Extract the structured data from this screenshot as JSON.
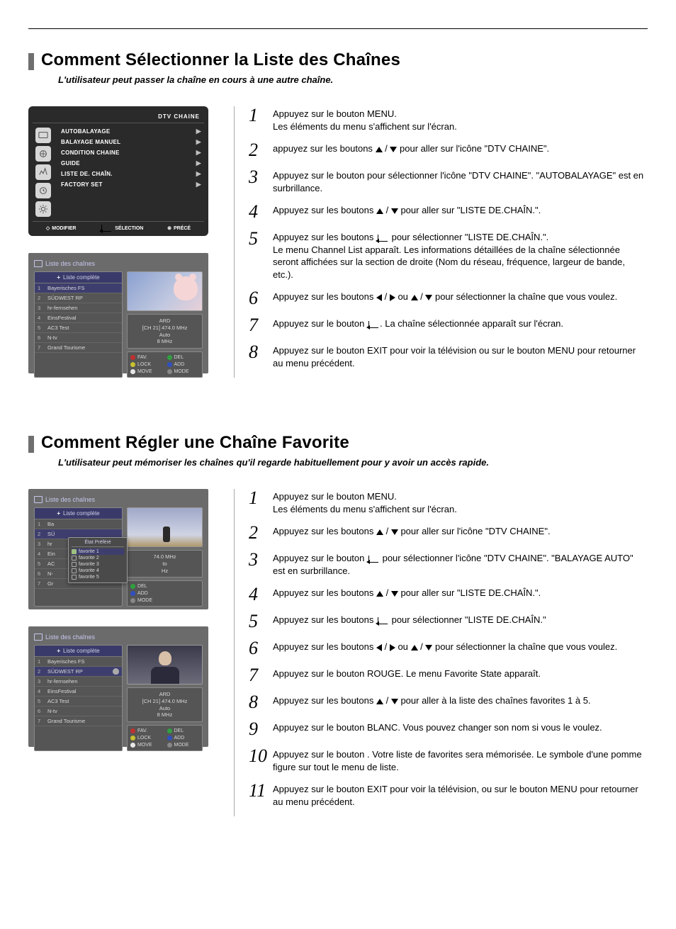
{
  "section1": {
    "title": "Comment Sélectionner la Liste des Chaînes",
    "subtitle": "L'utilisateur peut passer la chaîne en cours à une autre chaîne.",
    "osd": {
      "header": "DTV CHAINE",
      "items": [
        "AUTOBALAYAGE",
        "BALAYAGE MANUEL",
        "CONDITION CHAINE",
        "GUIDE",
        "LISTE DE. CHAÎN.",
        "FACTORY SET"
      ],
      "highlight_index": 4,
      "footer": {
        "modify": "MODIFIER",
        "select": "SÉLECTION",
        "back": "PRÉCÉ"
      }
    },
    "shot": {
      "title": "Liste des chaînes",
      "list_header": "Liste complète",
      "channels": [
        {
          "n": "1",
          "name": "Bayerisches FS"
        },
        {
          "n": "2",
          "name": "SÜDWEST RP"
        },
        {
          "n": "3",
          "name": "hr-fernsehen"
        },
        {
          "n": "4",
          "name": "EinsFestival"
        },
        {
          "n": "5",
          "name": "AC3 Test"
        },
        {
          "n": "6",
          "name": "N-tv"
        },
        {
          "n": "7",
          "name": "Grand Tourisme"
        }
      ],
      "info": {
        "name": "ARD",
        "ch": "[CH 21] 474.0 MHz",
        "mode": "Auto",
        "bw": "8 MHz"
      },
      "btns": {
        "fav": "FAV.",
        "del": "DEL",
        "lock": "LOCK",
        "add": "ADD",
        "move": "MOVE",
        "mode": "MODE"
      }
    },
    "steps": [
      {
        "n": "1",
        "t": "Appuyez sur le bouton MENU.\nLes éléments du menu s'affichent sur l'écran."
      },
      {
        "n": "2",
        "t": "appuyez sur les boutons {up} / {down} pour aller sur l'icône \"DTV CHAINE\"."
      },
      {
        "n": "3",
        "t": "Appuyez sur le bouton  pour sélectionner l'icône \"DTV CHAINE\". \"AUTOBALAYAGE\" est en surbrillance."
      },
      {
        "n": "4",
        "t": "Appuyez sur les boutons {up} / {down} pour aller sur \"LISTE DE.CHAÎN.\"."
      },
      {
        "n": "5",
        "t": "Appuyez sur les boutons {enter} pour sélectionner \"LISTE DE.CHAÎN.\".\nLe menu Channel List apparaît. Les informations détaillées de la chaîne sélectionnée seront affichées sur la section de droite (Nom du réseau, fréquence, largeur de bande, etc.)."
      },
      {
        "n": "6",
        "t": "Appuyez sur les boutons {left} / {right} ou {up} / {down} pour sélectionner la chaîne que vous voulez."
      },
      {
        "n": "7",
        "t": "Appuyez sur le bouton {enter}. La chaîne sélectionnée apparaît sur l'écran."
      },
      {
        "n": "8",
        "t": "Appuyez sur le bouton EXIT pour voir la télévision ou sur le bouton MENU pour retourner au menu précédent."
      }
    ]
  },
  "section2": {
    "title": "Comment Régler une Chaîne Favorite",
    "subtitle": "L'utilisateur peut mémoriser les chaînes qu'il regarde habituellement pour y avoir un accès rapide.",
    "shotA": {
      "title": "Liste des chaînes",
      "list_header": "Liste complète",
      "fav_header": "État Préféré",
      "channels": [
        {
          "n": "1",
          "name": "Ba"
        },
        {
          "n": "2",
          "name": "SÜ"
        },
        {
          "n": "3",
          "name": "hr"
        },
        {
          "n": "4",
          "name": "Ein"
        },
        {
          "n": "5",
          "name": "AC"
        },
        {
          "n": "6",
          "name": "N-"
        },
        {
          "n": "7",
          "name": "Gr"
        }
      ],
      "favs": [
        "favorite 1",
        "favorite 2",
        "favorite 3",
        "favorite 4",
        "favorite 5"
      ],
      "info_suffix": "74.0 MHz\nto\nHz",
      "btns": {
        "del": "DEL",
        "add": "ADD",
        "mode": "MODE"
      }
    },
    "shotB": {
      "title": "Liste des chaînes",
      "list_header": "Liste complète",
      "channels": [
        {
          "n": "1",
          "name": "Bayerisches FS"
        },
        {
          "n": "2",
          "name": "SÜDWEST RP"
        },
        {
          "n": "3",
          "name": "hr-fernsehen"
        },
        {
          "n": "4",
          "name": "EinsFestival"
        },
        {
          "n": "5",
          "name": "AC3 Test"
        },
        {
          "n": "6",
          "name": "N-tv"
        },
        {
          "n": "7",
          "name": "Grand Tourisme"
        }
      ],
      "info": {
        "name": "ARD",
        "ch": "[CH 21] 474.0 MHz",
        "mode": "Auto",
        "bw": "8 MHz"
      },
      "btns": {
        "fav": "FAV.",
        "del": "DEL",
        "lock": "LOCK",
        "add": "ADD",
        "move": "MOVE",
        "mode": "MODE"
      }
    },
    "steps": [
      {
        "n": "1",
        "t": "Appuyez sur le bouton MENU.\nLes éléments du menu s'affichent sur l'écran."
      },
      {
        "n": "2",
        "t": "Appuyez sur les boutons {up} / {down} pour aller sur l'icône \"DTV CHAINE\"."
      },
      {
        "n": "3",
        "t": "Appuyez sur le bouton {enter} pour sélectionner l'icône \"DTV CHAINE\". \"BALAYAGE AUTO\" est en surbrillance."
      },
      {
        "n": "4",
        "t": "Appuyez sur les boutons {up} / {down} pour aller sur \"LISTE DE.CHAÎN.\"."
      },
      {
        "n": "5",
        "t": "Appuyez sur les boutons {enter} pour sélectionner \"LISTE DE.CHAÎN.\""
      },
      {
        "n": "6",
        "t": "Appuyez sur les boutons {left} / {right} ou {up} / {down} pour sélectionner la chaîne que vous voulez."
      },
      {
        "n": "7",
        "t": "Appuyez sur le bouton ROUGE. Le menu Favorite State apparaît."
      },
      {
        "n": "8",
        "t": "Appuyez sur les boutons {up} / {down} pour aller à la liste des chaînes favorites 1 à 5."
      },
      {
        "n": "9",
        "t": "Appuyez sur le bouton BLANC. Vous pouvez changer son nom si vous le voulez."
      },
      {
        "n": "10",
        "t": "Appuyez sur le bouton . Votre liste de favorites sera mémorisée. Le symbole d'une pomme figure sur tout le menu de liste."
      },
      {
        "n": "11",
        "t": "Appuyez sur le bouton EXIT pour voir la télévision, ou sur le bouton MENU pour retourner au menu précédent."
      }
    ]
  }
}
